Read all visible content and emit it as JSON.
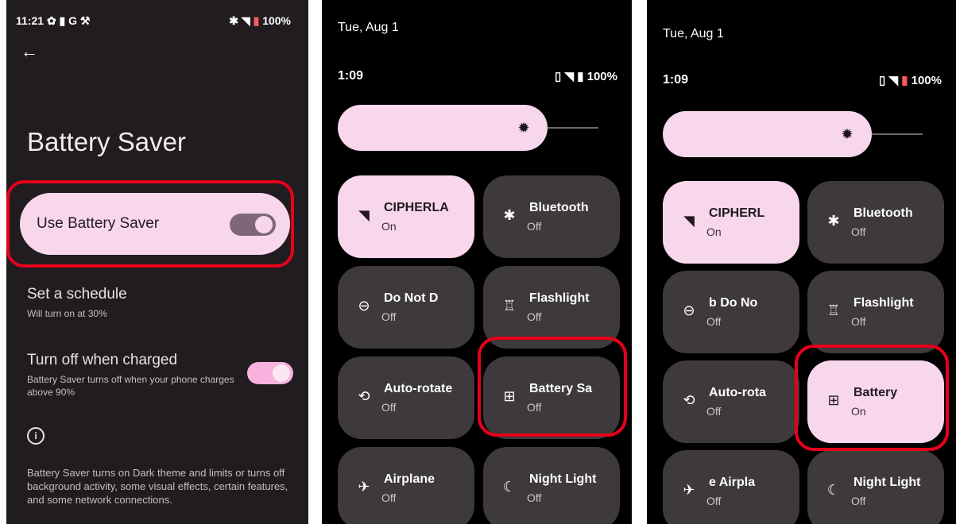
{
  "panel1": {
    "status": {
      "time": "11:21",
      "battery": "100%"
    },
    "page_title": "Battery Saver",
    "use_battery_saver": {
      "label": "Use Battery Saver",
      "on": true
    },
    "schedule": {
      "title": "Set a schedule",
      "subtitle": "Will turn on at 30%"
    },
    "turn_off": {
      "title": "Turn off when charged",
      "subtitle": "Battery Saver turns off when your phone charges above 90%",
      "on": true
    },
    "footer_text": "Battery Saver turns on Dark theme and limits or turns off background activity, some visual effects, certain features, and some network connections."
  },
  "panel2": {
    "date": "Tue, Aug 1",
    "time": "1:09",
    "battery": "100%",
    "tiles": [
      {
        "label": "CIPHERLA",
        "state": "On",
        "icon": "wifi-icon",
        "on": true
      },
      {
        "label": "Bluetooth",
        "state": "Off",
        "icon": "bluetooth-icon",
        "on": false
      },
      {
        "label": "Do Not D",
        "state": "Off",
        "icon": "do-not-disturb-icon",
        "on": false
      },
      {
        "label": "Flashlight",
        "state": "Off",
        "icon": "flashlight-icon",
        "on": false
      },
      {
        "label": "Auto-rotate",
        "state": "Off",
        "icon": "auto-rotate-icon",
        "on": false
      },
      {
        "label": "Battery Sa",
        "state": "Off",
        "icon": "battery-saver-icon",
        "on": false
      },
      {
        "label": "Airplane",
        "state": "Off",
        "icon": "airplane-icon",
        "on": false
      },
      {
        "label": "Night Light",
        "state": "Off",
        "icon": "night-light-icon",
        "on": false
      }
    ]
  },
  "panel3": {
    "date": "Tue, Aug 1",
    "time": "1:09",
    "battery": "100%",
    "tiles": [
      {
        "label": "CIPHERL",
        "state": "On",
        "icon": "wifi-icon",
        "on": true
      },
      {
        "label": "Bluetooth",
        "state": "Off",
        "icon": "bluetooth-icon",
        "on": false
      },
      {
        "label": "b  Do No",
        "state": "Off",
        "icon": "do-not-disturb-icon",
        "on": false
      },
      {
        "label": "Flashlight",
        "state": "Off",
        "icon": "flashlight-icon",
        "on": false
      },
      {
        "label": "Auto-rota",
        "state": "Off",
        "icon": "auto-rotate-icon",
        "on": false
      },
      {
        "label": "Battery",
        "state": "On",
        "icon": "battery-saver-icon",
        "on": true
      },
      {
        "label": "e  Airpla",
        "state": "Off",
        "icon": "airplane-icon",
        "on": false
      },
      {
        "label": "Night Light",
        "state": "Off",
        "icon": "night-light-icon",
        "on": false
      }
    ]
  }
}
